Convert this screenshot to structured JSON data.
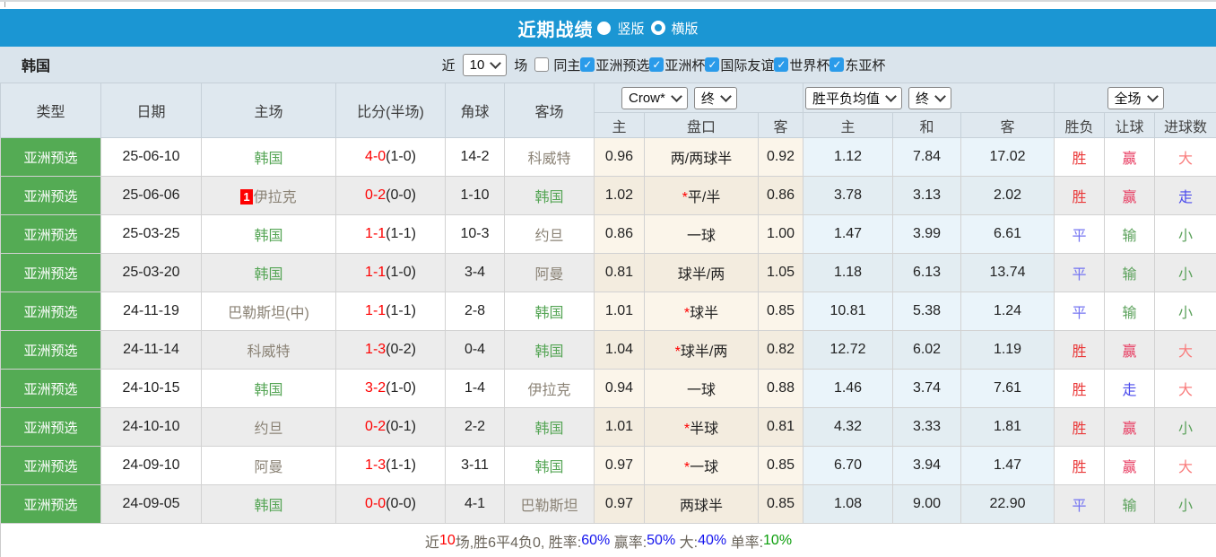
{
  "colors": {
    "accent": "#1b96d3",
    "barBg": "#dae4ec",
    "headerBg": "#dfe8ef",
    "greenCell": "#54ab54",
    "teamFocus": "#55a555",
    "scoreRed": "#fe0000",
    "checkboxBlue": "#2a9bea",
    "resultRed": "#ea3838",
    "resultBlue": "#5b5bef",
    "resultGreen": "#5ba15b"
  },
  "titlebar": {
    "title": "近期战绩",
    "radios": [
      {
        "label": "竖版",
        "selected": true
      },
      {
        "label": "横版",
        "selected": false
      }
    ]
  },
  "filterbar": {
    "team": "韩国",
    "near": "近",
    "count": "10",
    "count_suffix": "场",
    "checkboxes": [
      {
        "label": "同主",
        "checked": false
      },
      {
        "label": "亚洲预选",
        "checked": true
      },
      {
        "label": "亚洲杯",
        "checked": true
      },
      {
        "label": "国际友谊",
        "checked": true
      },
      {
        "label": "世界杯",
        "checked": true
      },
      {
        "label": "东亚杯",
        "checked": true
      }
    ]
  },
  "table": {
    "selects": {
      "odds_company": "Crow*",
      "odds_stage": "终",
      "avg_label": "胜平负均值",
      "avg_stage": "终",
      "scope": "全场"
    },
    "headers": {
      "type": "类型",
      "date": "日期",
      "home": "主场",
      "score": "比分(半场)",
      "corner": "角球",
      "away": "客场",
      "h": "主",
      "handicap": "盘口",
      "a": "客",
      "avg_h": "主",
      "avg_d": "和",
      "avg_a": "客",
      "result": "胜负",
      "handicap_result": "让球",
      "goals": "进球数"
    },
    "rows": [
      {
        "type": "亚洲预选",
        "date": "25-06-10",
        "home": "韩国",
        "homeFocus": true,
        "homeBadge": "",
        "score": "4-0",
        "half": "(1-0)",
        "corner": "14-2",
        "away": "科威特",
        "awayFocus": false,
        "oddsH": "0.96",
        "handicap": "两/两球半",
        "oddsA": "0.92",
        "avgH": "1.12",
        "avgD": "7.84",
        "avgA": "17.02",
        "res": "胜",
        "resC": "red",
        "let": "赢",
        "letC": "red",
        "goal": "大",
        "goalC": "red"
      },
      {
        "type": "亚洲预选",
        "date": "25-06-06",
        "home": "伊拉克",
        "homeFocus": false,
        "homeBadge": "1",
        "score": "0-2",
        "half": "(0-0)",
        "corner": "1-10",
        "away": "韩国",
        "awayFocus": true,
        "oddsH": "1.02",
        "handicap": "*平/半",
        "oddsA": "0.86",
        "avgH": "3.78",
        "avgD": "3.13",
        "avgA": "2.02",
        "res": "胜",
        "resC": "red",
        "let": "赢",
        "letC": "red",
        "goal": "走",
        "goalC": "blue"
      },
      {
        "type": "亚洲预选",
        "date": "25-03-25",
        "home": "韩国",
        "homeFocus": true,
        "homeBadge": "",
        "score": "1-1",
        "half": "(1-1)",
        "corner": "10-3",
        "away": "约旦",
        "awayFocus": false,
        "oddsH": "0.86",
        "handicap": "一球",
        "oddsA": "1.00",
        "avgH": "1.47",
        "avgD": "3.99",
        "avgA": "6.61",
        "res": "平",
        "resC": "blue",
        "let": "输",
        "letC": "green",
        "goal": "小",
        "goalC": "green"
      },
      {
        "type": "亚洲预选",
        "date": "25-03-20",
        "home": "韩国",
        "homeFocus": true,
        "homeBadge": "",
        "score": "1-1",
        "half": "(1-0)",
        "corner": "3-4",
        "away": "阿曼",
        "awayFocus": false,
        "oddsH": "0.81",
        "handicap": "球半/两",
        "oddsA": "1.05",
        "avgH": "1.18",
        "avgD": "6.13",
        "avgA": "13.74",
        "res": "平",
        "resC": "blue",
        "let": "输",
        "letC": "green",
        "goal": "小",
        "goalC": "green"
      },
      {
        "type": "亚洲预选",
        "date": "24-11-19",
        "home": "巴勒斯坦(中)",
        "homeFocus": false,
        "homeBadge": "",
        "score": "1-1",
        "half": "(1-1)",
        "corner": "2-8",
        "away": "韩国",
        "awayFocus": true,
        "oddsH": "1.01",
        "handicap": "*球半",
        "oddsA": "0.85",
        "avgH": "10.81",
        "avgD": "5.38",
        "avgA": "1.24",
        "res": "平",
        "resC": "blue",
        "let": "输",
        "letC": "green",
        "goal": "小",
        "goalC": "green"
      },
      {
        "type": "亚洲预选",
        "date": "24-11-14",
        "home": "科威特",
        "homeFocus": false,
        "homeBadge": "",
        "score": "1-3",
        "half": "(0-2)",
        "corner": "0-4",
        "away": "韩国",
        "awayFocus": true,
        "oddsH": "1.04",
        "handicap": "*球半/两",
        "oddsA": "0.82",
        "avgH": "12.72",
        "avgD": "6.02",
        "avgA": "1.19",
        "res": "胜",
        "resC": "red",
        "let": "赢",
        "letC": "red",
        "goal": "大",
        "goalC": "red"
      },
      {
        "type": "亚洲预选",
        "date": "24-10-15",
        "home": "韩国",
        "homeFocus": true,
        "homeBadge": "",
        "score": "3-2",
        "half": "(1-0)",
        "corner": "1-4",
        "away": "伊拉克",
        "awayFocus": false,
        "oddsH": "0.94",
        "handicap": "一球",
        "oddsA": "0.88",
        "avgH": "1.46",
        "avgD": "3.74",
        "avgA": "7.61",
        "res": "胜",
        "resC": "red",
        "let": "走",
        "letC": "blue",
        "goal": "大",
        "goalC": "red"
      },
      {
        "type": "亚洲预选",
        "date": "24-10-10",
        "home": "约旦",
        "homeFocus": false,
        "homeBadge": "",
        "score": "0-2",
        "half": "(0-1)",
        "corner": "2-2",
        "away": "韩国",
        "awayFocus": true,
        "oddsH": "1.01",
        "handicap": "*半球",
        "oddsA": "0.81",
        "avgH": "4.32",
        "avgD": "3.33",
        "avgA": "1.81",
        "res": "胜",
        "resC": "red",
        "let": "赢",
        "letC": "red",
        "goal": "小",
        "goalC": "green"
      },
      {
        "type": "亚洲预选",
        "date": "24-09-10",
        "home": "阿曼",
        "homeFocus": false,
        "homeBadge": "",
        "score": "1-3",
        "half": "(1-1)",
        "corner": "3-11",
        "away": "韩国",
        "awayFocus": true,
        "oddsH": "0.97",
        "handicap": "*一球",
        "oddsA": "0.85",
        "avgH": "6.70",
        "avgD": "3.94",
        "avgA": "1.47",
        "res": "胜",
        "resC": "red",
        "let": "赢",
        "letC": "red",
        "goal": "大",
        "goalC": "red"
      },
      {
        "type": "亚洲预选",
        "date": "24-09-05",
        "home": "韩国",
        "homeFocus": true,
        "homeBadge": "",
        "score": "0-0",
        "half": "(0-0)",
        "corner": "4-1",
        "away": "巴勒斯坦",
        "awayFocus": false,
        "oddsH": "0.97",
        "handicap": "两球半",
        "oddsA": "0.85",
        "avgH": "1.08",
        "avgD": "9.00",
        "avgA": "22.90",
        "res": "平",
        "resC": "blue",
        "let": "输",
        "letC": "green",
        "goal": "小",
        "goalC": "green"
      }
    ]
  },
  "footer": {
    "segments": [
      {
        "text": "近",
        "color": "dark"
      },
      {
        "text": "10",
        "color": "red"
      },
      {
        "text": "场,胜6平4负0, 胜率:",
        "color": "dark"
      },
      {
        "text": "60%",
        "color": "blue"
      },
      {
        "text": " 赢率:",
        "color": "dark"
      },
      {
        "text": "50%",
        "color": "blue"
      },
      {
        "text": " 大:",
        "color": "dark"
      },
      {
        "text": "40%",
        "color": "blue"
      },
      {
        "text": " 单率:",
        "color": "dark"
      },
      {
        "text": "10%",
        "color": "green"
      }
    ]
  }
}
